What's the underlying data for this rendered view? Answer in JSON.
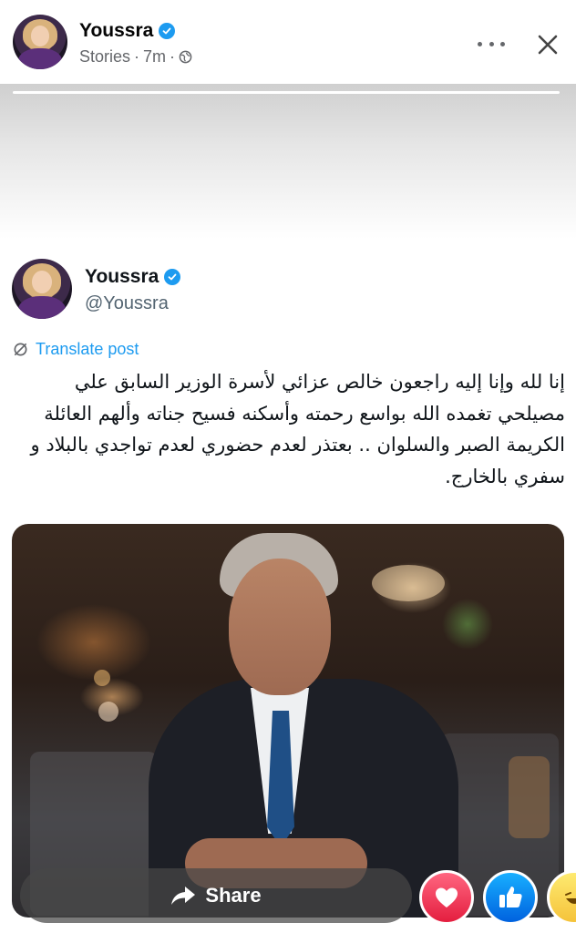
{
  "header": {
    "name": "Youssra",
    "source": "Stories",
    "time": "7m",
    "separator": "·"
  },
  "tweet": {
    "name": "Youssra",
    "handle": "@Youssra",
    "translate_label": "Translate post",
    "text": "إنا لله وإنا إليه راجعون خالص عزائي لأسرة الوزير السابق علي مصيلحي تغمده الله بواسع رحمته وأسكنه فسيح جناته وألهم العائلة الكريمة الصبر والسلوان .. بعتذر لعدم حضوري لعدم تواجدي بالبلاد و سفري بالخارج."
  },
  "actions": {
    "share_label": "Share"
  },
  "reactions": [
    "love",
    "like",
    "haha"
  ],
  "icons": {
    "verified": "verified-badge-icon",
    "globe": "globe-icon",
    "more": "more-horizontal-icon",
    "close": "close-icon",
    "translate": "translate-icon",
    "share": "share-arrow-icon"
  },
  "colors": {
    "verified": "#1d9bf0",
    "link": "#1d9bf0",
    "secondary_text": "#65676b",
    "love": "#e41e3f",
    "like": "#0866ff",
    "haha": "#f7b125"
  }
}
